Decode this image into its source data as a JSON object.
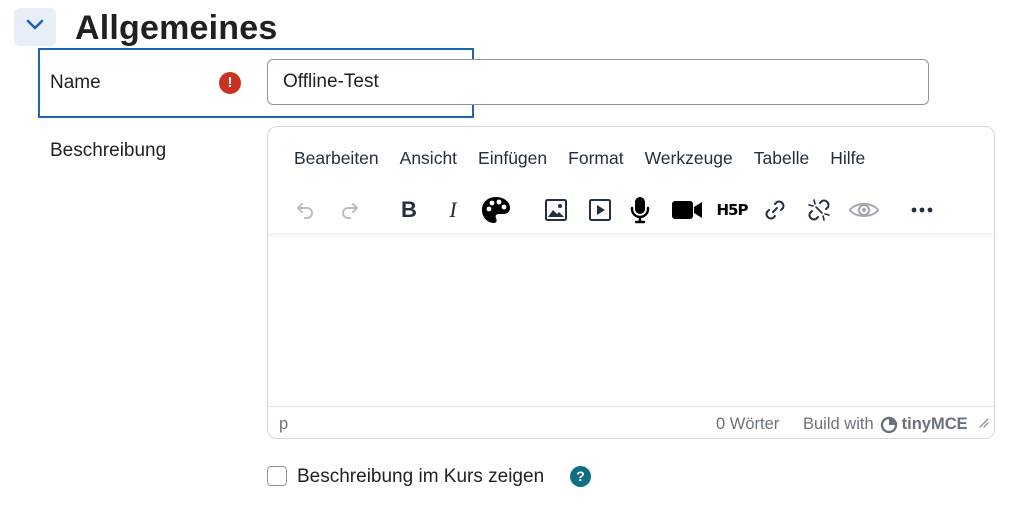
{
  "section": {
    "title": "Allgemeines",
    "collapse_icon": "chevron-down-icon"
  },
  "name_field": {
    "label": "Name",
    "required_icon": "exclamation-circle-icon",
    "required_symbol": "!",
    "value": "Offline-Test"
  },
  "description": {
    "label": "Beschreibung",
    "editor": {
      "menu": [
        "Bearbeiten",
        "Ansicht",
        "Einfügen",
        "Format",
        "Werkzeuge",
        "Tabelle",
        "Hilfe"
      ],
      "toolbar": [
        "undo-icon",
        "redo-icon",
        "bold-icon",
        "italic-icon",
        "palette-icon",
        "image-icon",
        "media-icon",
        "microphone-icon",
        "video-camera-icon",
        "h5p-icon",
        "link-icon",
        "unlink-icon",
        "eye-icon",
        "more-icon"
      ],
      "bold_glyph": "B",
      "italic_glyph": "I",
      "h5p_text": "H5P",
      "status_path": "p",
      "word_count": "0 Wörter",
      "build_with": "Build with",
      "brand": "tinyMCE"
    }
  },
  "show_description": {
    "label": "Beschreibung im Kurs zeigen",
    "checked": false,
    "help_symbol": "?"
  },
  "colors": {
    "accent_border": "#1e63b4",
    "required": "#ca3120",
    "help": "#0f6e84",
    "collapse_bg": "#e7eef8"
  }
}
